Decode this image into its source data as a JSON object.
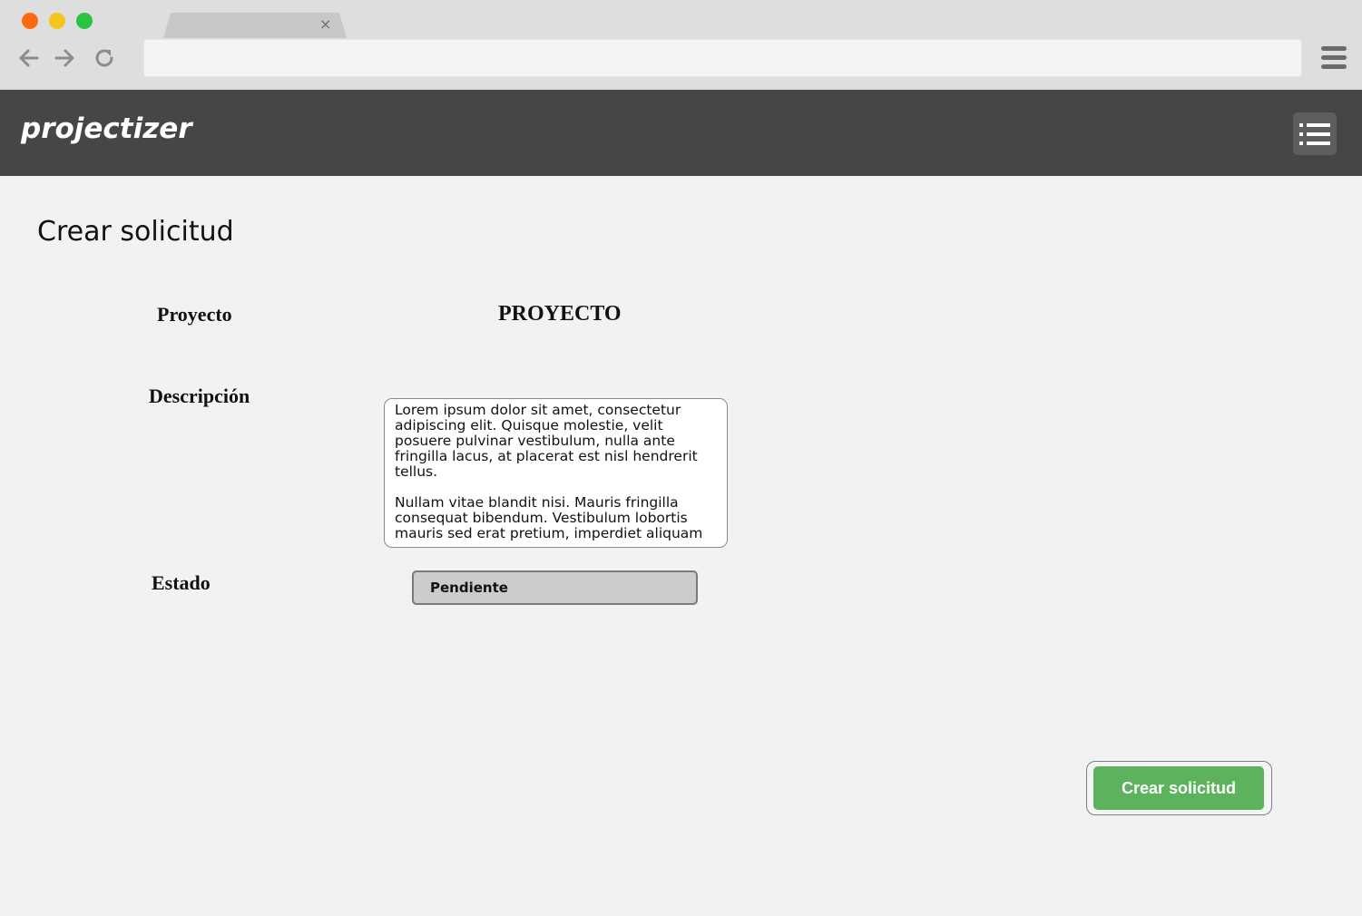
{
  "browser": {
    "tab_close": "×",
    "icons": [
      "back-arrow-icon",
      "forward-arrow-icon",
      "reload-icon",
      "browser-menu-icon"
    ]
  },
  "header": {
    "brand": "projectizer",
    "menu_icon": "list-menu-icon",
    "background": "#464646"
  },
  "page": {
    "title": "Crear solicitud"
  },
  "form": {
    "project_label": "Proyecto",
    "project_value": "PROYECTO",
    "description_label": "Descripción",
    "description_paragraphs": [
      "Lorem ipsum dolor sit amet, consectetur adipiscing elit. Quisque molestie, velit posuere pulvinar vestibulum, nulla ante fringilla lacus, at placerat est nisl hendrerit tellus.",
      "Nullam vitae blandit nisi. Mauris fringilla consequat bibendum. Vestibulum lobortis mauris sed erat pretium, imperdiet aliquam"
    ],
    "status_label": "Estado",
    "status_value": "Pendiente",
    "submit_label": "Crear solicitud",
    "submit_color": "#5cb25d"
  }
}
